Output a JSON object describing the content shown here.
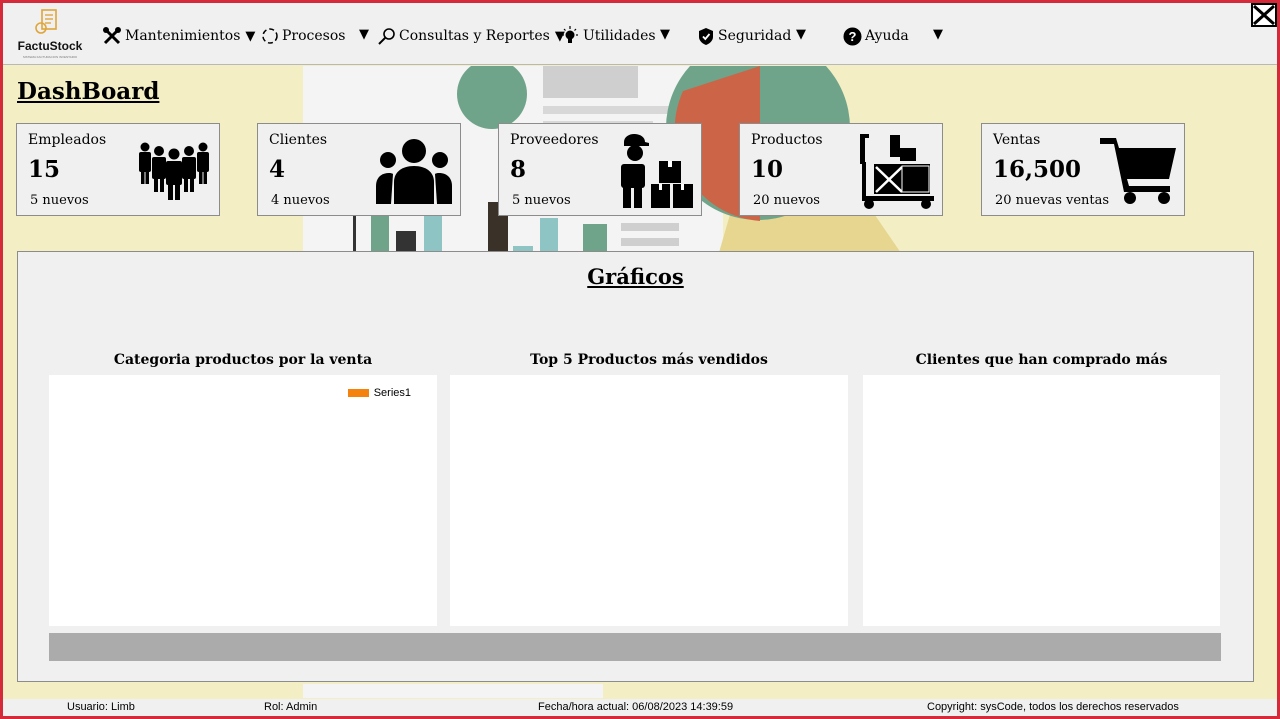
{
  "app": {
    "logo_text": "FactuStock",
    "logo_subtitle": "SISTEMA FACTURACION INVENTARIO"
  },
  "menu": {
    "mantenimientos": "Mantenimientos",
    "procesos": "Procesos",
    "consultas": "Consultas y Reportes",
    "utilidades": "Utilidades",
    "seguridad": "Seguridad",
    "ayuda": "Ayuda",
    "caret": "▼"
  },
  "dashboard": {
    "title": "DashBoard"
  },
  "cards": [
    {
      "label": "Empleados",
      "value": "15",
      "sub": "5 nuevos",
      "icon": "people-group-icon"
    },
    {
      "label": "Clientes",
      "value": "4",
      "sub": "4 nuevos",
      "icon": "users-icon"
    },
    {
      "label": "Proveedores",
      "value": "8",
      "sub": "5 nuevos",
      "icon": "supplier-boxes-icon"
    },
    {
      "label": "Productos",
      "value": "10",
      "sub": "20 nuevos",
      "icon": "hand-truck-icon"
    },
    {
      "label": "Ventas",
      "value": "16,500",
      "sub": "20 nuevas ventas",
      "icon": "shopping-cart-icon"
    }
  ],
  "graficos": {
    "title": "Gráficos",
    "charts": [
      {
        "title": "Categoria productos por la venta",
        "legend": "Series1"
      },
      {
        "title": "Top 5 Productos más vendidos"
      },
      {
        "title": "Clientes que han comprado más"
      }
    ]
  },
  "status": {
    "usuario": "Usuario: Limb",
    "rol": "Rol: Admin",
    "fecha": "Fecha/hora actual: 06/08/2023 14:39:59",
    "copyright": "Copyright: sysCode, todos los derechos reservados"
  },
  "colors": {
    "frame": "#d42a3a",
    "background": "#f4eec4",
    "panel": "#f0f0f0",
    "legend_series1": "#f5820d",
    "scrollbar": "#ababab"
  }
}
